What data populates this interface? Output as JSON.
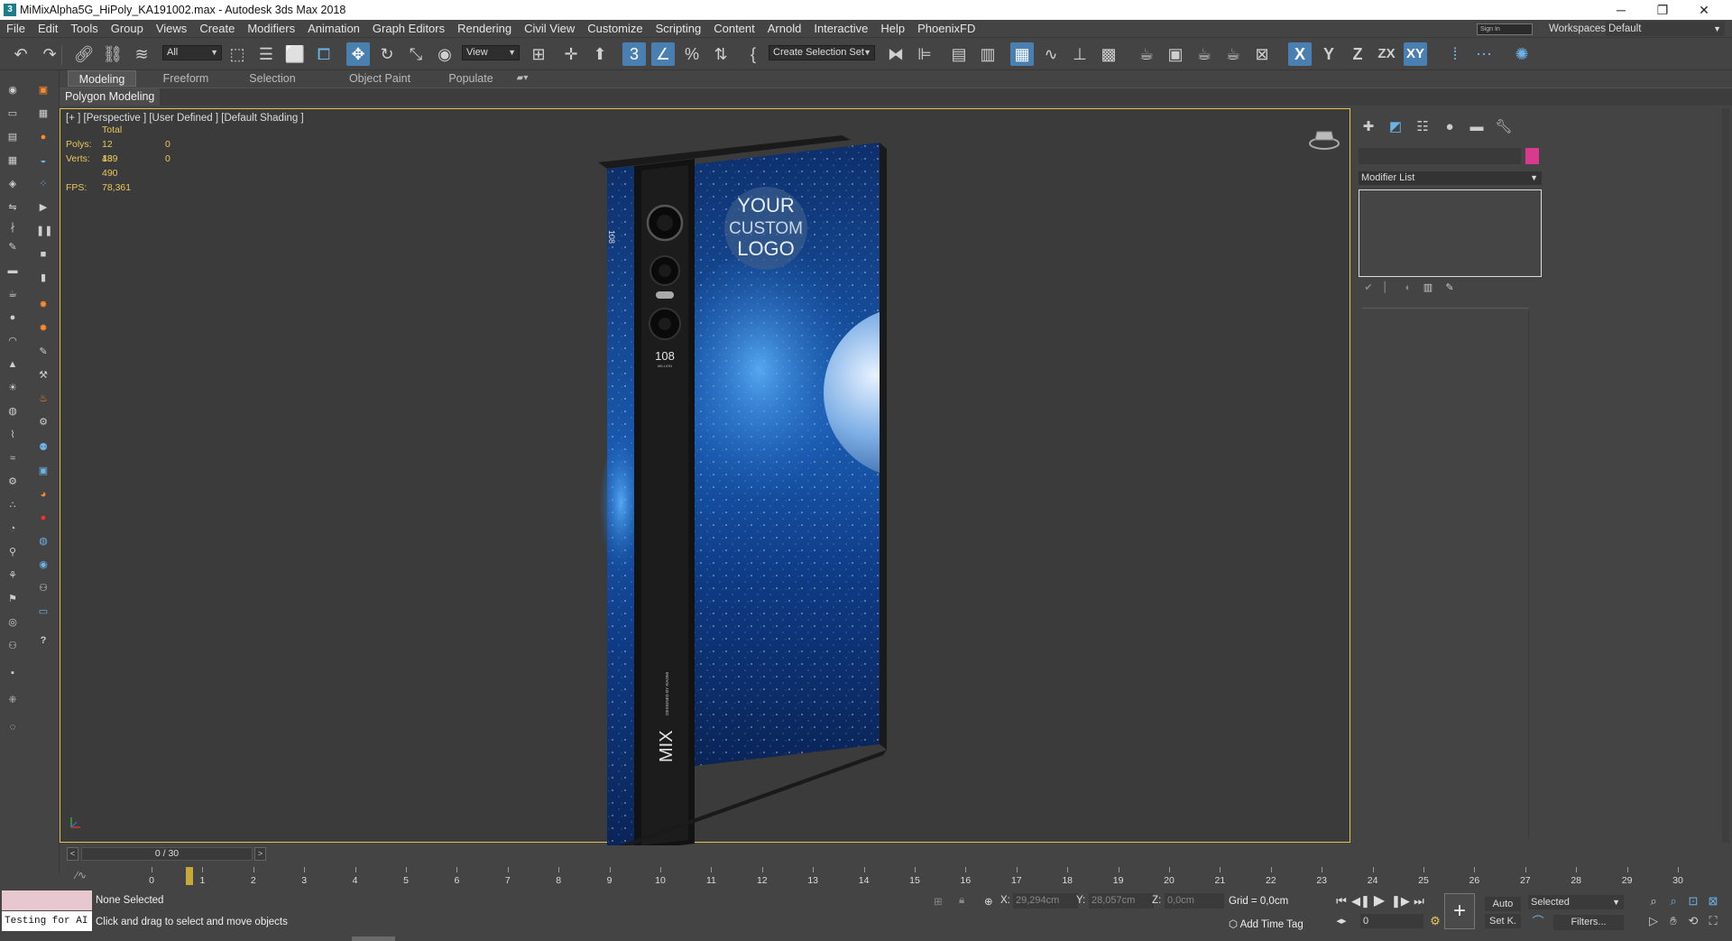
{
  "window": {
    "title": "MiMixAlpha5G_HiPoly_KA191002.max - Autodesk 3ds Max 2018",
    "app_icon_text": "3",
    "minimize": "─",
    "restore": "❐",
    "close": "✕"
  },
  "menu": [
    "File",
    "Edit",
    "Tools",
    "Group",
    "Views",
    "Create",
    "Modifiers",
    "Animation",
    "Graph Editors",
    "Rendering",
    "Civil View",
    "Customize",
    "Scripting",
    "Content",
    "Arnold",
    "Interactive",
    "Help",
    "PhoenixFD"
  ],
  "signin": "Sign In",
  "workspaces": {
    "label": "Workspaces:",
    "value": "Default"
  },
  "toolbar": {
    "selection_filter": "All",
    "ref_coord": "View",
    "named_selection": "Create Selection Set",
    "axis_labels": [
      "X",
      "Y",
      "Z",
      "ZX",
      "XY"
    ]
  },
  "ribbon": {
    "tabs": [
      "Modeling",
      "Freeform",
      "Selection",
      "Object Paint",
      "Populate"
    ],
    "panel_label": "Polygon Modeling"
  },
  "viewport": {
    "label": "[+ ] [Perspective ] [User Defined ] [Default Shading ]",
    "stats": {
      "header": "Total",
      "polys_label": "Polys:",
      "polys_total": "12 489",
      "polys_sel": "0",
      "verts_label": "Verts:",
      "verts_total": "13 490",
      "verts_sel": "0",
      "fps_label": "FPS:",
      "fps": "78,361"
    },
    "phone": {
      "logo_line1": "YOUR",
      "logo_line2": "CUSTOM",
      "logo_line3": "LOGO",
      "cam_text_top": "108",
      "cam_text_bottom": "MILLION",
      "brand": "MIX",
      "designed_by": "DESIGNED BY XIAOMI",
      "side_text": "108"
    }
  },
  "command_panel": {
    "modifier_list": "Modifier List",
    "object_color": "#d83a8e"
  },
  "time": {
    "frame_display": "0 / 30",
    "prev": "<",
    "next": ">",
    "ticks": [
      "0",
      "1",
      "2",
      "3",
      "4",
      "5",
      "6",
      "7",
      "8",
      "9",
      "10",
      "11",
      "12",
      "13",
      "14",
      "15",
      "16",
      "17",
      "18",
      "19",
      "20",
      "21",
      "22",
      "23",
      "24",
      "25",
      "26",
      "27",
      "28",
      "29",
      "30"
    ]
  },
  "status": {
    "maxscript_text": "Testing for AI",
    "selection": "None Selected",
    "prompt": "Click and drag to select and move objects",
    "x_label": "X:",
    "x_value": "29,294cm",
    "y_label": "Y:",
    "y_value": "28,057cm",
    "z_label": "Z:",
    "z_value": "0,0cm",
    "grid": "Grid = 0,0cm",
    "add_time_tag": "Add Time Tag",
    "auto": "Auto",
    "set_key": "Set K.",
    "selected": "Selected",
    "filters": "Filters...",
    "current_frame": "0"
  }
}
